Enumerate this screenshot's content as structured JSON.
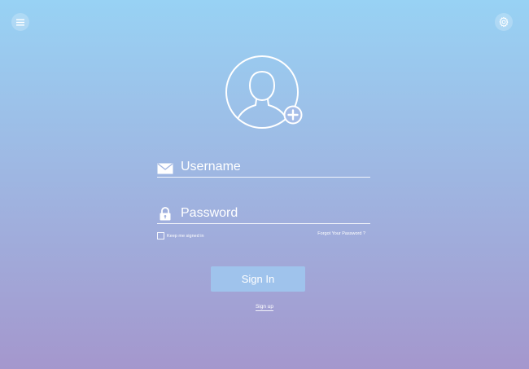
{
  "header": {
    "menu_icon": "menu-icon",
    "settings_icon": "gear-icon"
  },
  "avatar": {
    "icon": "user-icon",
    "badge_icon": "plus-icon"
  },
  "form": {
    "username_placeholder": "Username",
    "username_value": "",
    "username_icon": "envelope-icon",
    "password_placeholder": "Password",
    "password_value": "",
    "password_icon": "lock-icon",
    "keep_signed_in_label": "Keep me signed in",
    "keep_signed_in_checked": false,
    "forgot_password_label": "Forgot Your Password ?",
    "signin_label": "Sign In",
    "signup_label": "Sign up"
  },
  "colors": {
    "gradient_top": "#98d2f4",
    "gradient_bottom": "#a497cd",
    "signin_button": "#9fc3ec",
    "foreground": "#ffffff"
  }
}
